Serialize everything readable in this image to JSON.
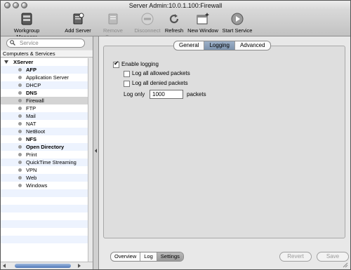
{
  "window": {
    "title": "Server Admin:10.0.1.100:Firewall"
  },
  "toolbar": {
    "items": [
      {
        "label": "Workgroup Manager",
        "icon": "workgroup-manager-icon",
        "enabled": true
      },
      {
        "label": "Add Server",
        "icon": "add-server-icon",
        "enabled": true
      },
      {
        "label": "Remove Server",
        "icon": "remove-server-icon",
        "enabled": false
      },
      {
        "label": "Disconnect",
        "icon": "disconnect-icon",
        "enabled": false
      },
      {
        "label": "Refresh",
        "icon": "refresh-icon",
        "enabled": true
      },
      {
        "label": "New Window",
        "icon": "new-window-icon",
        "enabled": true
      },
      {
        "label": "Start Service",
        "icon": "start-service-icon",
        "enabled": true
      }
    ]
  },
  "search": {
    "placeholder": "Service"
  },
  "sidebar": {
    "header": "Computers & Services",
    "server": "XServer",
    "services": [
      {
        "label": "AFP",
        "bold": true
      },
      {
        "label": "Application Server",
        "bold": false
      },
      {
        "label": "DHCP",
        "bold": false
      },
      {
        "label": "DNS",
        "bold": true
      },
      {
        "label": "Firewall",
        "bold": false,
        "selected": true
      },
      {
        "label": "FTP",
        "bold": false
      },
      {
        "label": "Mail",
        "bold": false
      },
      {
        "label": "NAT",
        "bold": false
      },
      {
        "label": "NetBoot",
        "bold": false
      },
      {
        "label": "NFS",
        "bold": true
      },
      {
        "label": "Open Directory",
        "bold": true
      },
      {
        "label": "Print",
        "bold": false
      },
      {
        "label": "QuickTime Streaming",
        "bold": false
      },
      {
        "label": "VPN",
        "bold": false
      },
      {
        "label": "Web",
        "bold": false
      },
      {
        "label": "Windows",
        "bold": false
      }
    ]
  },
  "tabs": {
    "general": "General",
    "logging": "Logging",
    "advanced": "Advanced",
    "active": "Logging"
  },
  "logging": {
    "enable_label": "Enable logging",
    "enable_checked": true,
    "allowed_label": "Log all allowed packets",
    "allowed_checked": false,
    "denied_label": "Log all denied packets",
    "denied_checked": false,
    "log_only_label": "Log only",
    "log_only_value": "1000",
    "packets_label": "packets"
  },
  "bottom": {
    "tabs": {
      "overview": "Overview",
      "log": "Log",
      "settings": "Settings",
      "active": "Settings"
    },
    "revert": "Revert",
    "save": "Save"
  },
  "colors": {
    "accent_tab": "#8ea3bd",
    "row_stripe": "#edf3fe",
    "disabled_text": "#9a9a9a"
  }
}
